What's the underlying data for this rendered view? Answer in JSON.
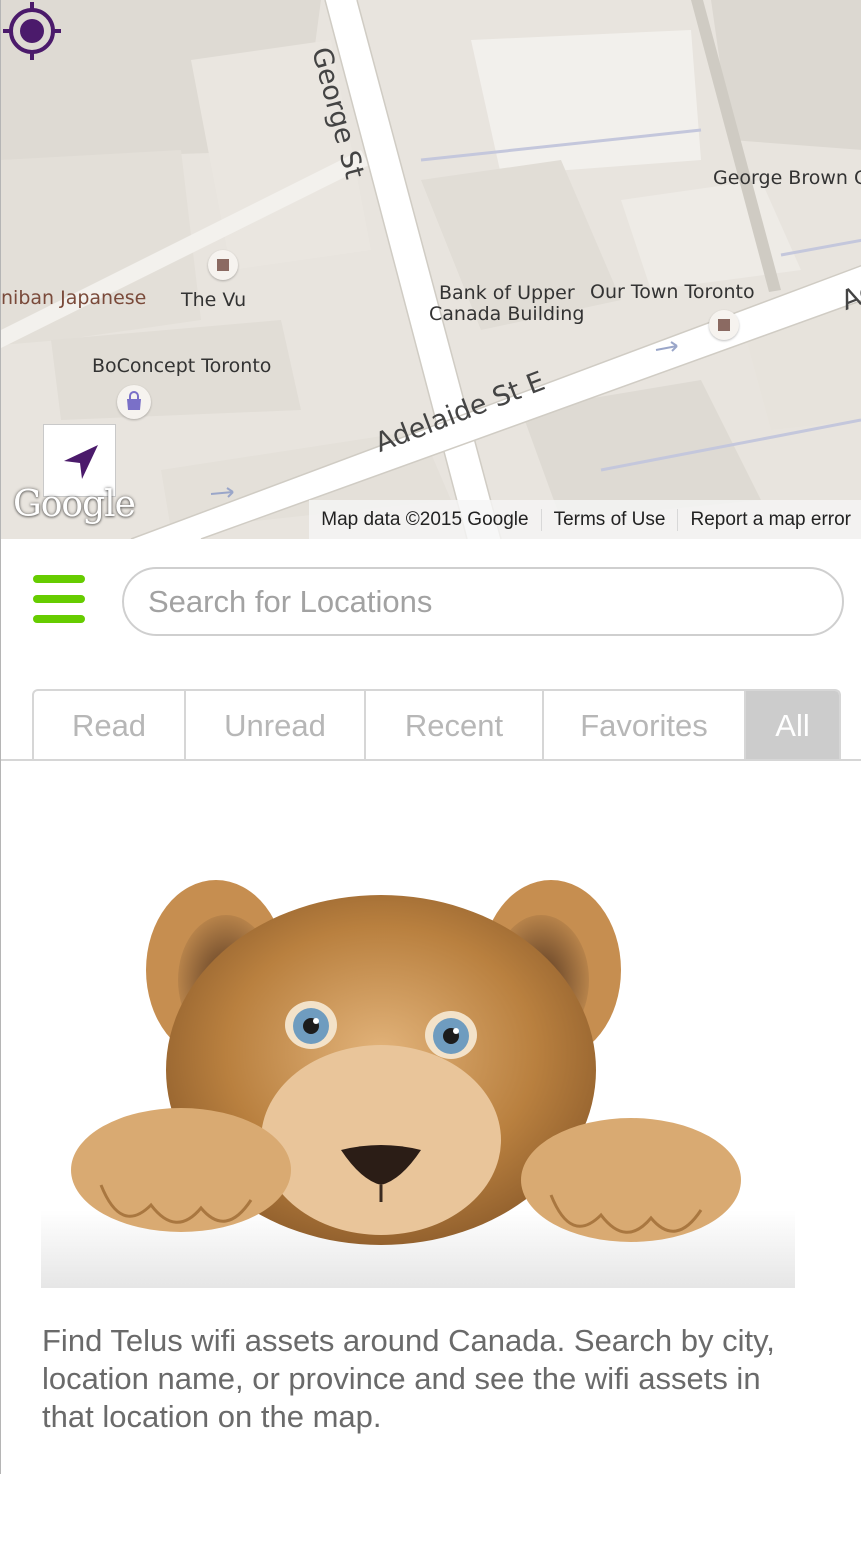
{
  "map": {
    "labels": {
      "george_st": "George St",
      "george_brown": "George Brown C",
      "bank": "Bank of Upper",
      "bank2": "Canada Building",
      "our_town": "Our Town Toronto",
      "the_vu": "The Vu",
      "nibian": "niban Japanese",
      "boconcept": "BoConcept Toronto",
      "adelaide": "Adelaide St E",
      "adelaide_edge": "Ad"
    },
    "google_logo": "Google",
    "attribution": {
      "map_data": "Map data ©2015 Google",
      "terms": "Terms of Use",
      "report": "Report a map error"
    },
    "icons": {
      "locate": "navigation-arrow-icon",
      "target": "crosshair-target-icon",
      "shop": "shopping-bag-icon"
    }
  },
  "menu": {
    "icon": "hamburger-menu-icon",
    "color": "#66cc00"
  },
  "search": {
    "placeholder": "Search for Locations",
    "value": ""
  },
  "tabs": [
    {
      "label": "Read",
      "active": false
    },
    {
      "label": "Unread",
      "active": false
    },
    {
      "label": "Recent",
      "active": false
    },
    {
      "label": "Favorites",
      "active": false
    },
    {
      "label": "All",
      "active": true
    }
  ],
  "hero": {
    "subject": "lion-cub-illustration"
  },
  "description": "Find Telus wifi assets around Canada. Search by city, location name, or province and see the wifi assets in that location on the map.",
  "colors": {
    "accent_green": "#66cc00",
    "pin_purple": "#4b1a6b",
    "active_tab_bg": "#cccccc"
  }
}
